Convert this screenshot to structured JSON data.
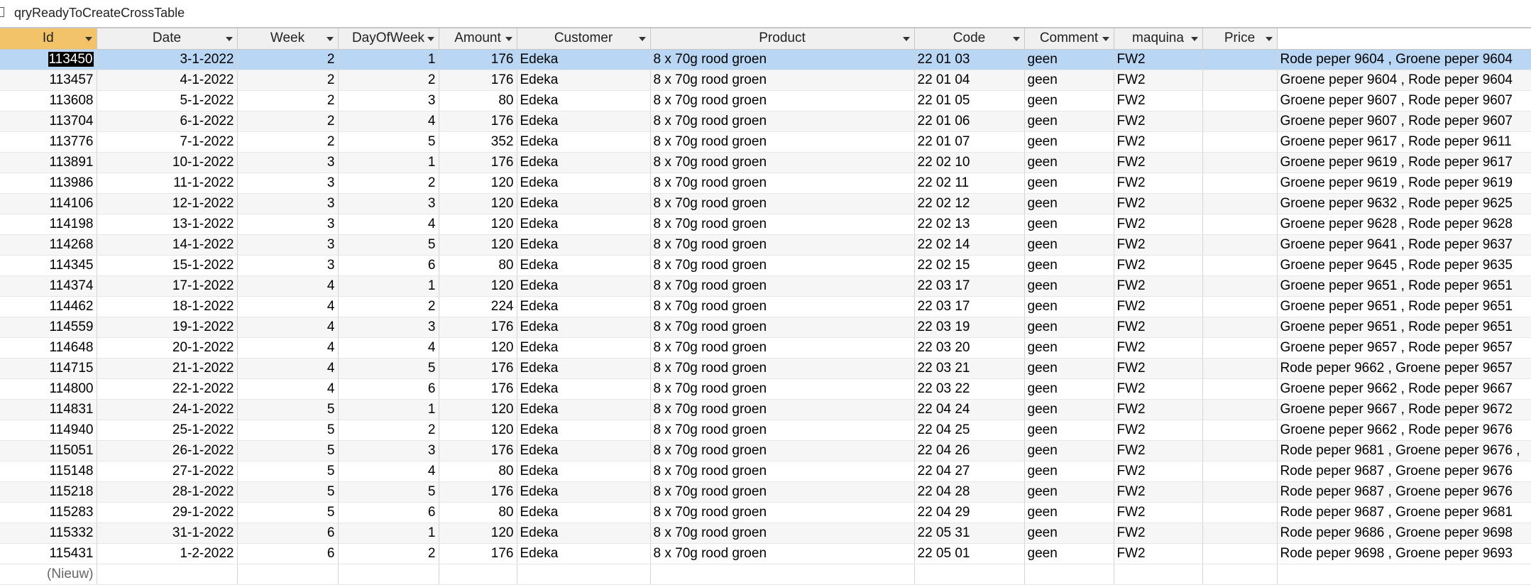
{
  "window": {
    "title": "qryReadyToCreateCrossTable"
  },
  "columns": [
    "Id",
    "Date",
    "Week",
    "DayOfWeek",
    "Amount",
    "Customer",
    "Product",
    "Code",
    "Comment",
    "maquina",
    "Price"
  ],
  "rows": [
    {
      "id": "113450",
      "date": "3-1-2022",
      "week": "2",
      "dow": "1",
      "amount": "176",
      "customer": "Edeka",
      "product": "8 x 70g rood groen",
      "code": "22 01 03",
      "comment": "geen",
      "maquina": "FW2",
      "price": "",
      "extra": "Rode peper 9604 , Groene peper 9604"
    },
    {
      "id": "113457",
      "date": "4-1-2022",
      "week": "2",
      "dow": "2",
      "amount": "176",
      "customer": "Edeka",
      "product": "8 x 70g rood groen",
      "code": "22 01 04",
      "comment": "geen",
      "maquina": "FW2",
      "price": "",
      "extra": "Groene peper 9604 , Rode peper 9604"
    },
    {
      "id": "113608",
      "date": "5-1-2022",
      "week": "2",
      "dow": "3",
      "amount": "80",
      "customer": "Edeka",
      "product": "8 x 70g rood groen",
      "code": "22 01 05",
      "comment": "geen",
      "maquina": "FW2",
      "price": "",
      "extra": "Groene peper 9607 , Rode peper 9607"
    },
    {
      "id": "113704",
      "date": "6-1-2022",
      "week": "2",
      "dow": "4",
      "amount": "176",
      "customer": "Edeka",
      "product": "8 x 70g rood groen",
      "code": "22 01 06",
      "comment": "geen",
      "maquina": "FW2",
      "price": "",
      "extra": "Groene peper 9607 , Rode peper 9607"
    },
    {
      "id": "113776",
      "date": "7-1-2022",
      "week": "2",
      "dow": "5",
      "amount": "352",
      "customer": "Edeka",
      "product": "8 x 70g rood groen",
      "code": "22 01 07",
      "comment": "geen",
      "maquina": "FW2",
      "price": "",
      "extra": "Groene peper 9617 , Rode peper 9611"
    },
    {
      "id": "113891",
      "date": "10-1-2022",
      "week": "3",
      "dow": "1",
      "amount": "176",
      "customer": "Edeka",
      "product": "8 x 70g rood groen",
      "code": "22 02 10",
      "comment": "geen",
      "maquina": "FW2",
      "price": "",
      "extra": "Groene peper 9619 , Rode peper 9617"
    },
    {
      "id": "113986",
      "date": "11-1-2022",
      "week": "3",
      "dow": "2",
      "amount": "120",
      "customer": "Edeka",
      "product": "8 x 70g rood groen",
      "code": "22 02 11",
      "comment": "geen",
      "maquina": "FW2",
      "price": "",
      "extra": "Groene peper 9619 , Rode peper 9619"
    },
    {
      "id": "114106",
      "date": "12-1-2022",
      "week": "3",
      "dow": "3",
      "amount": "120",
      "customer": "Edeka",
      "product": "8 x 70g rood groen",
      "code": "22 02 12",
      "comment": "geen",
      "maquina": "FW2",
      "price": "",
      "extra": "Groene peper 9632 , Rode peper 9625"
    },
    {
      "id": "114198",
      "date": "13-1-2022",
      "week": "3",
      "dow": "4",
      "amount": "120",
      "customer": "Edeka",
      "product": "8 x 70g rood groen",
      "code": "22 02 13",
      "comment": "geen",
      "maquina": "FW2",
      "price": "",
      "extra": "Groene peper 9628 , Rode peper 9628"
    },
    {
      "id": "114268",
      "date": "14-1-2022",
      "week": "3",
      "dow": "5",
      "amount": "120",
      "customer": "Edeka",
      "product": "8 x 70g rood groen",
      "code": "22 02 14",
      "comment": "geen",
      "maquina": "FW2",
      "price": "",
      "extra": "Groene peper 9641 , Rode peper 9637"
    },
    {
      "id": "114345",
      "date": "15-1-2022",
      "week": "3",
      "dow": "6",
      "amount": "80",
      "customer": "Edeka",
      "product": "8 x 70g rood groen",
      "code": "22 02 15",
      "comment": "geen",
      "maquina": "FW2",
      "price": "",
      "extra": "Groene peper 9645 , Rode peper 9635"
    },
    {
      "id": "114374",
      "date": "17-1-2022",
      "week": "4",
      "dow": "1",
      "amount": "120",
      "customer": "Edeka",
      "product": "8 x 70g rood groen",
      "code": "22 03 17",
      "comment": "geen",
      "maquina": "FW2",
      "price": "",
      "extra": "Groene peper 9651 , Rode peper 9651"
    },
    {
      "id": "114462",
      "date": "18-1-2022",
      "week": "4",
      "dow": "2",
      "amount": "224",
      "customer": "Edeka",
      "product": "8 x 70g rood groen",
      "code": "22 03 17",
      "comment": "geen",
      "maquina": "FW2",
      "price": "",
      "extra": "Groene peper 9651 , Rode peper 9651"
    },
    {
      "id": "114559",
      "date": "19-1-2022",
      "week": "4",
      "dow": "3",
      "amount": "176",
      "customer": "Edeka",
      "product": "8 x 70g rood groen",
      "code": "22 03 19",
      "comment": "geen",
      "maquina": "FW2",
      "price": "",
      "extra": "Groene peper 9651 , Rode peper 9651"
    },
    {
      "id": "114648",
      "date": "20-1-2022",
      "week": "4",
      "dow": "4",
      "amount": "120",
      "customer": "Edeka",
      "product": "8 x 70g rood groen",
      "code": "22 03 20",
      "comment": "geen",
      "maquina": "FW2",
      "price": "",
      "extra": "Groene peper 9657 , Rode peper 9657"
    },
    {
      "id": "114715",
      "date": "21-1-2022",
      "week": "4",
      "dow": "5",
      "amount": "176",
      "customer": "Edeka",
      "product": "8 x 70g rood groen",
      "code": "22 03 21",
      "comment": "geen",
      "maquina": "FW2",
      "price": "",
      "extra": "Rode peper 9662 , Groene peper 9657"
    },
    {
      "id": "114800",
      "date": "22-1-2022",
      "week": "4",
      "dow": "6",
      "amount": "176",
      "customer": "Edeka",
      "product": "8 x 70g rood groen",
      "code": "22 03 22",
      "comment": "geen",
      "maquina": "FW2",
      "price": "",
      "extra": "Groene peper 9662 , Rode peper 9667"
    },
    {
      "id": "114831",
      "date": "24-1-2022",
      "week": "5",
      "dow": "1",
      "amount": "120",
      "customer": "Edeka",
      "product": "8 x 70g rood groen",
      "code": "22 04 24",
      "comment": "geen",
      "maquina": "FW2",
      "price": "",
      "extra": "Groene peper 9667 , Rode peper 9672"
    },
    {
      "id": "114940",
      "date": "25-1-2022",
      "week": "5",
      "dow": "2",
      "amount": "120",
      "customer": "Edeka",
      "product": "8 x 70g rood groen",
      "code": "22 04 25",
      "comment": "geen",
      "maquina": "FW2",
      "price": "",
      "extra": "Groene peper 9662 , Rode peper 9676"
    },
    {
      "id": "115051",
      "date": "26-1-2022",
      "week": "5",
      "dow": "3",
      "amount": "176",
      "customer": "Edeka",
      "product": "8 x 70g rood groen",
      "code": "22 04 26",
      "comment": "geen",
      "maquina": "FW2",
      "price": "",
      "extra": "Rode peper 9681 , Groene peper 9676 ,"
    },
    {
      "id": "115148",
      "date": "27-1-2022",
      "week": "5",
      "dow": "4",
      "amount": "80",
      "customer": "Edeka",
      "product": "8 x 70g rood groen",
      "code": "22 04 27",
      "comment": "geen",
      "maquina": "FW2",
      "price": "",
      "extra": "Rode peper 9687 , Groene peper 9676"
    },
    {
      "id": "115218",
      "date": "28-1-2022",
      "week": "5",
      "dow": "5",
      "amount": "176",
      "customer": "Edeka",
      "product": "8 x 70g rood groen",
      "code": "22 04 28",
      "comment": "geen",
      "maquina": "FW2",
      "price": "",
      "extra": "Rode peper 9687 , Groene peper 9676"
    },
    {
      "id": "115283",
      "date": "29-1-2022",
      "week": "5",
      "dow": "6",
      "amount": "80",
      "customer": "Edeka",
      "product": "8 x 70g rood groen",
      "code": "22 04 29",
      "comment": "geen",
      "maquina": "FW2",
      "price": "",
      "extra": "Rode peper 9687 , Groene peper 9681"
    },
    {
      "id": "115332",
      "date": "31-1-2022",
      "week": "6",
      "dow": "1",
      "amount": "120",
      "customer": "Edeka",
      "product": "8 x 70g rood groen",
      "code": "22 05 31",
      "comment": "geen",
      "maquina": "FW2",
      "price": "",
      "extra": "Rode peper 9686 , Groene peper 9698"
    },
    {
      "id": "115431",
      "date": "1-2-2022",
      "week": "6",
      "dow": "2",
      "amount": "176",
      "customer": "Edeka",
      "product": "8 x 70g rood groen",
      "code": "22 05 01",
      "comment": "geen",
      "maquina": "FW2",
      "price": "",
      "extra": "Rode peper 9698 , Groene peper 9693"
    }
  ],
  "new_row_label": "(Nieuw)",
  "colors": {
    "selected_row": "#b9d7f4",
    "selected_header": "#f3c36a",
    "header_bg": "#f0f0f0"
  }
}
